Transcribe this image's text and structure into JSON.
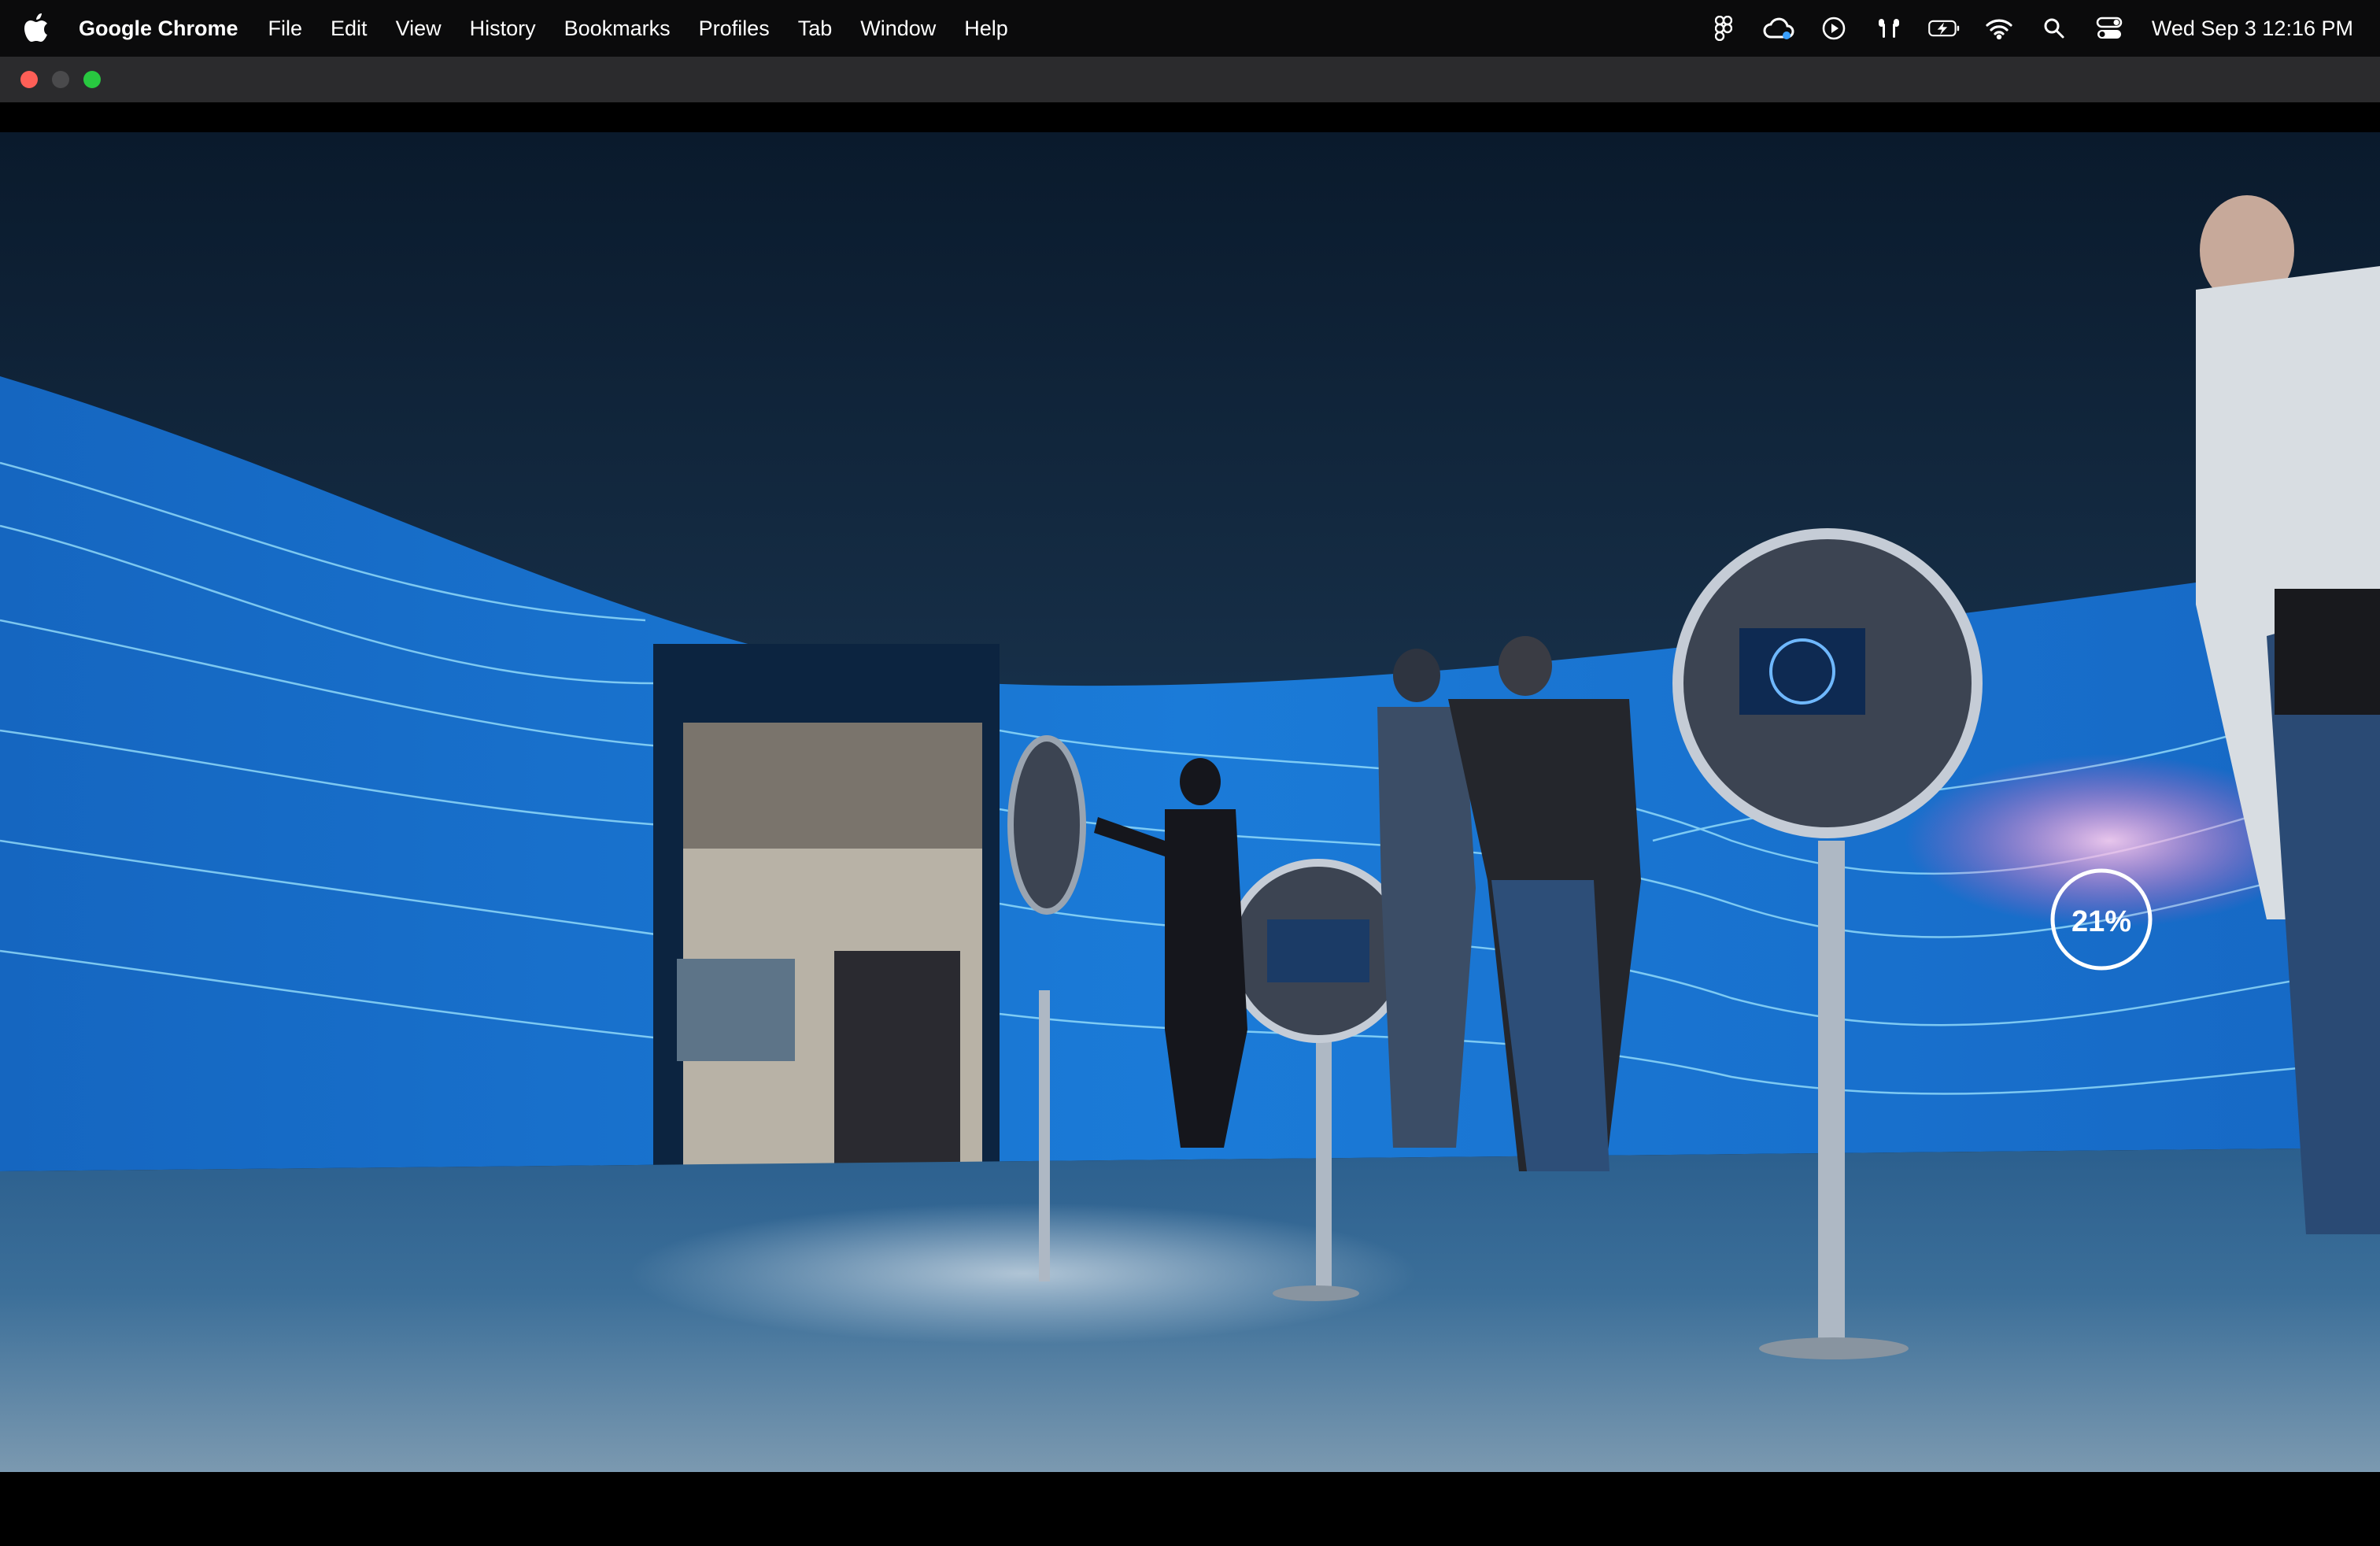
{
  "menubar": {
    "app_name": "Google Chrome",
    "items": [
      "File",
      "Edit",
      "View",
      "History",
      "Bookmarks",
      "Profiles",
      "Tab",
      "Window",
      "Help"
    ],
    "clock": "Wed Sep 3  12:16 PM",
    "status_icons": [
      "figma-icon",
      "creative-cloud-icon",
      "play-circle-icon",
      "airpods-icon",
      "battery-charging-icon",
      "wifi-icon",
      "search-icon",
      "control-center-icon"
    ]
  },
  "video": {
    "overlay_stat": "21%"
  },
  "colors": {
    "menubar_bg": "#0b0b0c",
    "titlebar_bg": "#2b2b2d",
    "close": "#fe5f57",
    "minimize": "#4a4a4c",
    "maximize": "#28c840",
    "wall_blue": "#1f7fd6"
  }
}
